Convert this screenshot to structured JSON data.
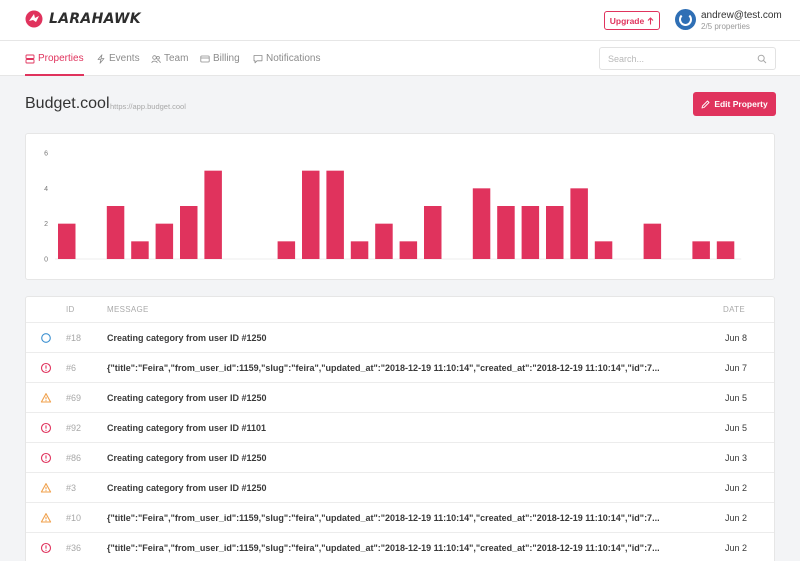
{
  "brand": {
    "name": "LARAHAWK",
    "accent": "#e0335d"
  },
  "header": {
    "upgrade_label": "Upgrade",
    "user_email": "andrew@test.com",
    "user_properties": "2/5 properties"
  },
  "nav": {
    "items": [
      {
        "label": "Properties",
        "icon": "properties-icon",
        "active": true
      },
      {
        "label": "Events",
        "icon": "bolt-icon",
        "active": false
      },
      {
        "label": "Team",
        "icon": "team-icon",
        "active": false
      },
      {
        "label": "Billing",
        "icon": "card-icon",
        "active": false
      },
      {
        "label": "Notifications",
        "icon": "chat-icon",
        "active": false
      }
    ],
    "search_placeholder": "Search..."
  },
  "property": {
    "title": "Budget.cool",
    "url": "https://app.budget.cool",
    "edit_label": "Edit Property"
  },
  "chart_data": {
    "type": "bar",
    "ylim": [
      0,
      6
    ],
    "yticks": [
      0,
      2,
      4,
      6
    ],
    "grid": false,
    "color": "#e0335d",
    "values": [
      2,
      0,
      3,
      1,
      2,
      3,
      5,
      0,
      0,
      1,
      5,
      5,
      1,
      2,
      1,
      3,
      0,
      4,
      3,
      3,
      3,
      4,
      1,
      0,
      2,
      0,
      1,
      1
    ]
  },
  "table": {
    "columns": {
      "id": "ID",
      "message": "MESSAGE",
      "date": "DATE"
    },
    "rows": [
      {
        "status": "circle",
        "id": "#18",
        "message": "Creating category from user ID #1250",
        "date": "Jun 8"
      },
      {
        "status": "error",
        "id": "#6",
        "message": "{\"title\":\"Feira\",\"from_user_id\":1159,\"slug\":\"feira\",\"updated_at\":\"2018-12-19 11:10:14\",\"created_at\":\"2018-12-19 11:10:14\",\"id\":7...",
        "date": "Jun 7"
      },
      {
        "status": "warning",
        "id": "#69",
        "message": "Creating category from user ID #1250",
        "date": "Jun 5"
      },
      {
        "status": "error",
        "id": "#92",
        "message": "Creating category from user ID #1101",
        "date": "Jun 5"
      },
      {
        "status": "error",
        "id": "#86",
        "message": "Creating category from user ID #1250",
        "date": "Jun 3"
      },
      {
        "status": "warning",
        "id": "#3",
        "message": "Creating category from user ID #1250",
        "date": "Jun 2"
      },
      {
        "status": "warning",
        "id": "#10",
        "message": "{\"title\":\"Feira\",\"from_user_id\":1159,\"slug\":\"feira\",\"updated_at\":\"2018-12-19 11:10:14\",\"created_at\":\"2018-12-19 11:10:14\",\"id\":7...",
        "date": "Jun 2"
      },
      {
        "status": "error",
        "id": "#36",
        "message": "{\"title\":\"Feira\",\"from_user_id\":1159,\"slug\":\"feira\",\"updated_at\":\"2018-12-19 11:10:14\",\"created_at\":\"2018-12-19 11:10:14\",\"id\":7...",
        "date": "Jun 2"
      }
    ]
  },
  "status_colors": {
    "circle": "#3a8fd0",
    "error": "#e0335d",
    "warning": "#f0a04b"
  }
}
